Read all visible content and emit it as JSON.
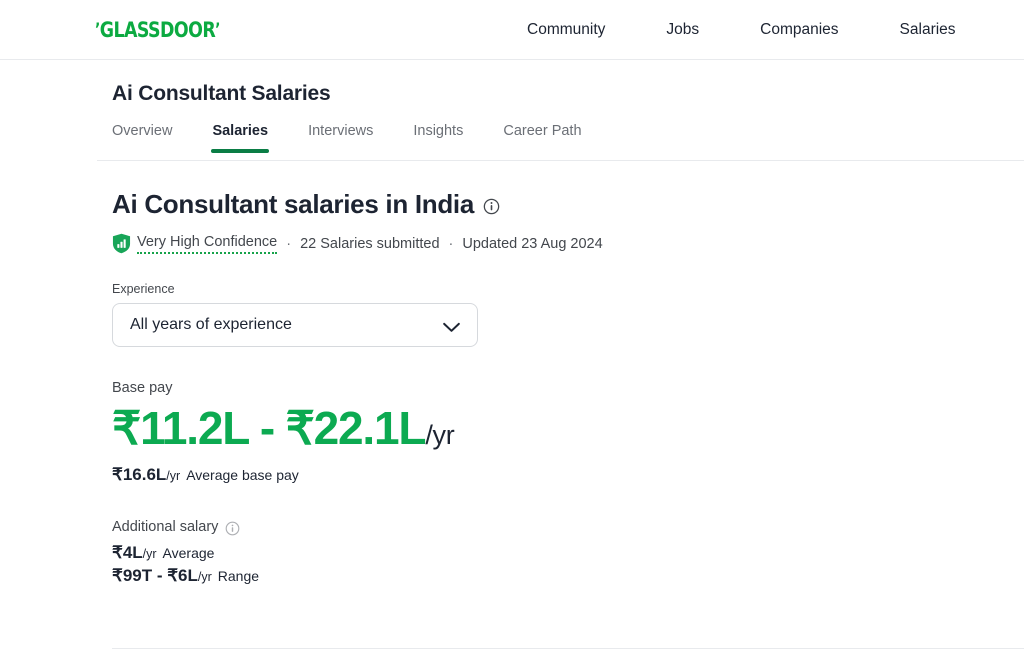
{
  "header": {
    "logo_text": "GLASSDOOR",
    "logo_quote_left": "’",
    "logo_quote_right": "’",
    "nav": [
      {
        "label": "Community",
        "name": "nav-community"
      },
      {
        "label": "Jobs",
        "name": "nav-jobs"
      },
      {
        "label": "Companies",
        "name": "nav-companies"
      },
      {
        "label": "Salaries",
        "name": "nav-salaries"
      }
    ]
  },
  "job": {
    "title": "Ai Consultant Salaries",
    "tabs": [
      {
        "label": "Overview",
        "active": false
      },
      {
        "label": "Salaries",
        "active": true
      },
      {
        "label": "Interviews",
        "active": false
      },
      {
        "label": "Insights",
        "active": false
      },
      {
        "label": "Career Path",
        "active": false
      }
    ]
  },
  "main": {
    "heading": "Ai Consultant salaries in India",
    "heading_info_icon": "info-icon",
    "confidence_badge_icon": "shield-bar-chart-icon",
    "confidence_label": "Very High Confidence",
    "separator": "·",
    "salaries_submitted": "22 Salaries submitted",
    "updated": "Updated 23 Aug 2024",
    "experience": {
      "label": "Experience",
      "selected": "All years of experience",
      "chevron_icon": "chevron-down-icon"
    },
    "base_pay": {
      "label": "Base pay",
      "range": "₹11.2L - ₹22.1L",
      "range_unit": "/yr",
      "average_value": "₹16.6L",
      "average_unit": "/yr",
      "average_label": "Average base pay"
    },
    "additional_salary": {
      "label": "Additional salary",
      "info_icon": "info-icon",
      "average_value": "₹4L",
      "average_unit": "/yr",
      "average_label": "Average",
      "range_value": "₹99T - ₹6L",
      "range_unit": "/yr",
      "range_label": "Range"
    }
  },
  "colors": {
    "brand_green": "#0caa41",
    "accent_green": "#0caa51",
    "tab_underline": "#0a7d45",
    "text_primary": "#1d2432",
    "text_secondary": "#43474d",
    "text_muted": "#6b6f76",
    "border": "#e8eaed"
  }
}
